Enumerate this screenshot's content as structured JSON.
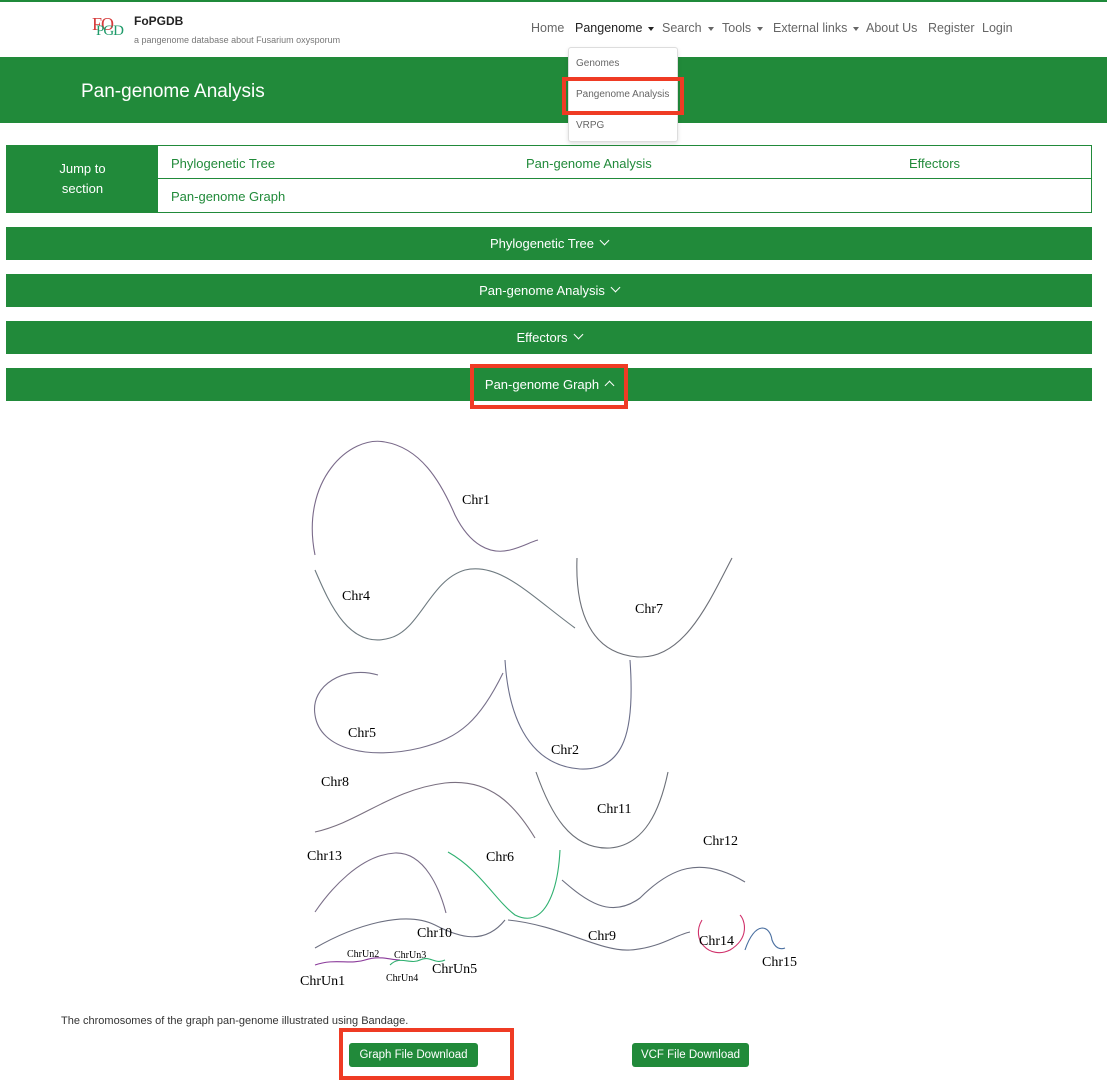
{
  "brand": {
    "logo_top": "FO",
    "logo_bottom": "PGD",
    "name": "FoPGDB",
    "subtitle": "a pangenome database about Fusarium oxysporum"
  },
  "nav": {
    "home": "Home",
    "pangenome": "Pangenome",
    "search": "Search",
    "tools": "Tools",
    "external_links": "External links",
    "about": "About Us",
    "register": "Register",
    "login": "Login"
  },
  "pangenome_menu": {
    "items": [
      "Genomes",
      "Pangenome Analysis",
      "VRPG"
    ]
  },
  "banner": {
    "title": "Pan-genome Analysis"
  },
  "jump": {
    "label_line1": "Jump to",
    "label_line2": "section",
    "links": [
      "Phylogenetic Tree",
      "Pan-genome Analysis",
      "Effectors",
      "Pan-genome Graph"
    ]
  },
  "sections": [
    "Phylogenetic Tree",
    "Pan-genome Analysis",
    "Effectors",
    "Pan-genome Graph"
  ],
  "graph": {
    "labels": [
      "Chr1",
      "Chr4",
      "Chr7",
      "Chr5",
      "Chr2",
      "Chr8",
      "Chr11",
      "Chr13",
      "Chr6",
      "Chr12",
      "Chr10",
      "Chr9",
      "Chr14",
      "Chr15",
      "ChrUn1",
      "ChrUn2",
      "ChrUn3",
      "ChrUn4",
      "ChrUn5"
    ]
  },
  "caption": "The chromosomes of the graph pan-genome illustrated using Bandage.",
  "buttons": {
    "graph_download": "Graph File Download",
    "vcf_download": "VCF File Download"
  },
  "colors": {
    "primary": "#218a3a",
    "highlight": "#ef3b24"
  }
}
